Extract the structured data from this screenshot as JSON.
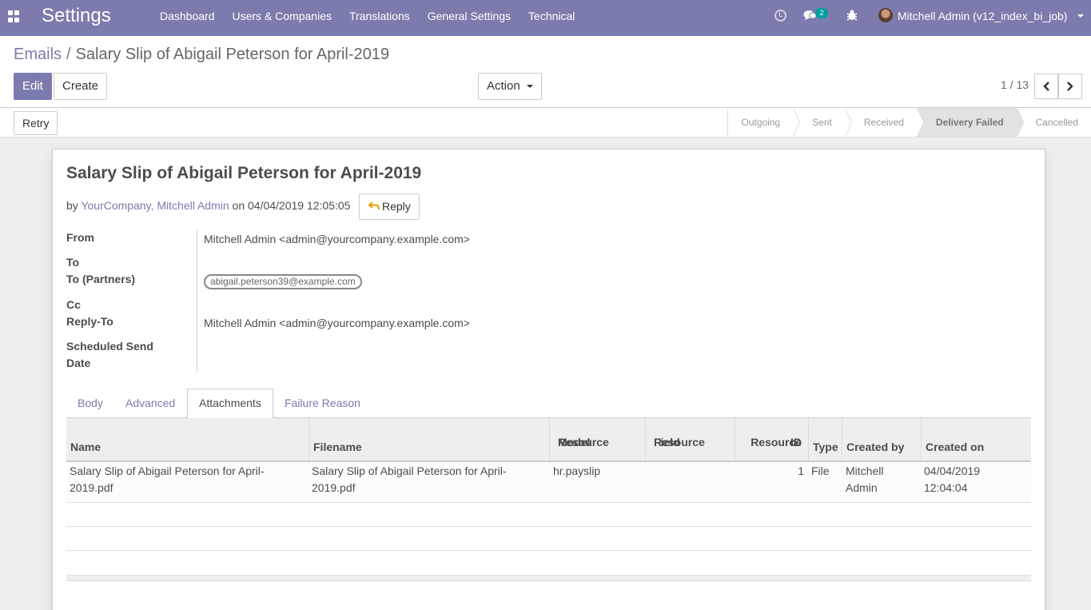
{
  "navbar": {
    "brand": "Settings",
    "menu": [
      "Dashboard",
      "Users & Companies",
      "Translations",
      "General Settings",
      "Technical"
    ],
    "messages_count": "2",
    "user": "Mitchell Admin (v12_index_bi_job)",
    "accent": "#7c7bad"
  },
  "breadcrumb": {
    "parent": "Emails",
    "sep": "/",
    "current": "Salary Slip of Abigail Peterson for April-2019"
  },
  "buttons": {
    "edit": "Edit",
    "create": "Create",
    "action": "Action",
    "retry": "Retry"
  },
  "pager": {
    "text": "1 / 13"
  },
  "stages": [
    {
      "label": "Outgoing",
      "active": false
    },
    {
      "label": "Sent",
      "active": false
    },
    {
      "label": "Received",
      "active": false
    },
    {
      "label": "Delivery Failed",
      "active": true
    },
    {
      "label": "Cancelled",
      "active": false
    }
  ],
  "message": {
    "subject": "Salary Slip of Abigail Peterson for April-2019",
    "by": "by",
    "author": "YourCompany, Mitchell Admin",
    "on": "on 04/04/2019 12:05:05",
    "reply": "Reply"
  },
  "fields": {
    "from_label": "From",
    "from_value": "Mitchell Admin <admin@yourcompany.example.com>",
    "to_label": "To",
    "to_partners_label": "To (Partners)",
    "to_partners_tag": "abigail.peterson39@example.com",
    "cc_label": "Cc",
    "reply_to_label": "Reply-To",
    "reply_to_value": "Mitchell Admin <admin@yourcompany.example.com>",
    "scheduled_label_1": "Scheduled Send",
    "scheduled_label_2": "Date"
  },
  "tabs": [
    "Body",
    "Advanced",
    "Attachments",
    "Failure Reason"
  ],
  "table": {
    "headers": {
      "name": "Name",
      "filename": "Filename",
      "res_model_1": "Resource",
      "res_model_2": "Model",
      "res_field_1": "Resource",
      "res_field_2": "Field",
      "res_id_1": "Resource",
      "res_id_2": "ID",
      "type": "Type",
      "created_by": "Created by",
      "created_on": "Created on"
    },
    "row": {
      "name_1": "Salary Slip of Abigail Peterson for April-",
      "name_2": "2019.pdf",
      "filename_1": "Salary Slip of Abigail Peterson for April-",
      "filename_2": "2019.pdf",
      "res_model": "hr.payslip",
      "res_id": "1",
      "type": "File",
      "created_by_1": "Mitchell",
      "created_by_2": "Admin",
      "created_on_1": "04/04/2019",
      "created_on_2": "12:04:04"
    }
  }
}
